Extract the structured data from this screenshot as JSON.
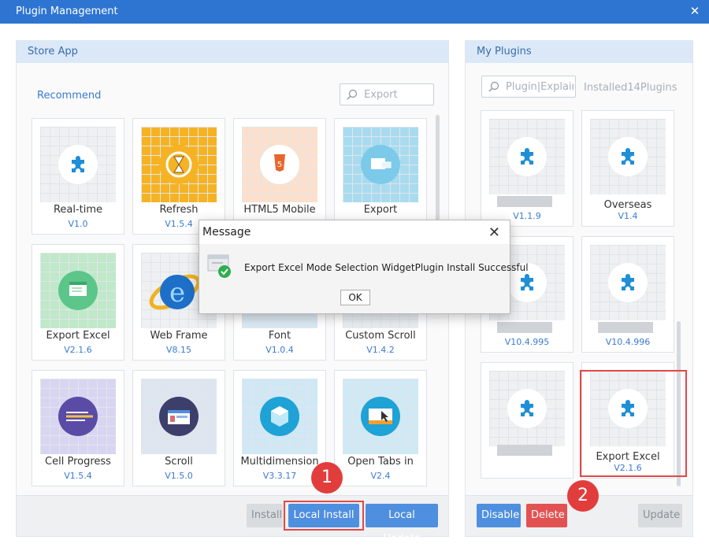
{
  "window": {
    "title": "Plugin Management",
    "close_icon": "close-icon"
  },
  "store": {
    "header": "Store App",
    "tab": "Recommend",
    "search_placeholder": "Export",
    "cards": [
      {
        "name": "Real-time",
        "version": "V1.0",
        "icon": "puzzle-icon"
      },
      {
        "name": "Refresh",
        "version": "V1.5.4",
        "icon": "hourglass-refresh-icon"
      },
      {
        "name": "HTML5 Mobile",
        "version": "",
        "icon": "html5-icon"
      },
      {
        "name": "Export",
        "version": "",
        "icon": "export-icon"
      },
      {
        "name": "Export Excel",
        "version": "V2.1.6",
        "icon": "excel-export-icon"
      },
      {
        "name": "Web Frame",
        "version": "V8.15",
        "icon": "ie-browser-icon"
      },
      {
        "name": "Font",
        "version": "V1.0.4",
        "icon": "font-icon"
      },
      {
        "name": "Custom Scroll",
        "version": "V1.4.2",
        "icon": "scroll-icon"
      },
      {
        "name": "Cell Progress",
        "version": "V1.5.4",
        "icon": "progress-icon"
      },
      {
        "name": "Scroll",
        "version": "V1.5.0",
        "icon": "scroll-table-icon"
      },
      {
        "name": "Multidimension",
        "version": "V3.3.17",
        "icon": "cube-icon"
      },
      {
        "name": "Open Tabs in",
        "version": "V2.4",
        "icon": "tabs-cursor-icon"
      }
    ],
    "buttons": {
      "install": "Install",
      "local_install": "Local Install",
      "local_update": "Local Update"
    }
  },
  "mine": {
    "header": "My Plugins",
    "search_placeholder": "Plugin|Explain",
    "count": "Installed14Plugins",
    "cards": [
      {
        "name": "",
        "version": "V1.1.9",
        "icon": "puzzle-icon"
      },
      {
        "name": "Overseas",
        "version": "V1.4",
        "icon": "puzzle-icon"
      },
      {
        "name": "",
        "version": "V10.4.995",
        "icon": "puzzle-icon"
      },
      {
        "name": "",
        "version": "V10.4.996",
        "icon": "puzzle-icon"
      },
      {
        "name": "",
        "version": "",
        "icon": "puzzle-icon"
      },
      {
        "name": "Export Excel",
        "version": "V2.1.6",
        "icon": "puzzle-icon"
      }
    ],
    "buttons": {
      "disable": "Disable",
      "delete": "Delete",
      "update": "Update"
    }
  },
  "badges": [
    "1",
    "2"
  ],
  "dialog": {
    "title": "Message",
    "message": "Export Excel Mode Selection WidgetPlugin Install Successful",
    "ok": "OK"
  },
  "colors": {
    "titlebar": "#2e75d2",
    "accent": "#3b7ad2",
    "delete": "#e35252",
    "highlight": "#e04848"
  }
}
